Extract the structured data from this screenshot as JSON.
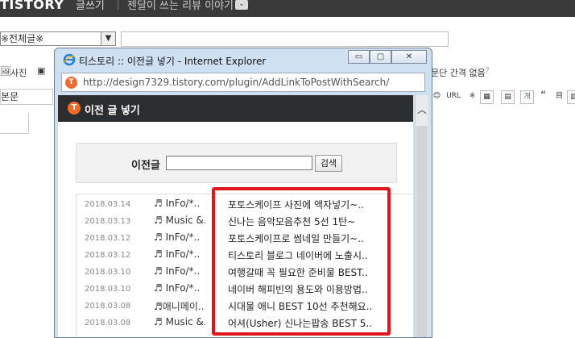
{
  "app": {
    "logo": "TISTORY",
    "page_name": "글쓰기",
    "blog_name": "젠달이 쓰는 리뷰 이야기",
    "blog_dropdown": "⌄"
  },
  "editor": {
    "category_value": "※전체글※",
    "toolbar1": {
      "photo_label": "사진",
      "paragraph_spacing_label": "문단 간격 없음"
    },
    "format_value": "본문",
    "toolbar2_buttons": [
      "😊",
      "URL",
      "※",
      "▦",
      "▤",
      "개",
      "“",
      "目",
      "▥"
    ]
  },
  "popup": {
    "window_title": "티스토리 :: 이전글 넣기 - Internet Explorer",
    "url": "http://design7329.tistory.com/plugin/AddLinkToPostWithSearch/",
    "header_title": "이전 글 넣기",
    "search_label": "이전글",
    "search_button": "검색",
    "posts": [
      {
        "date": "2018.03.14",
        "category": "♬ InFo/*..",
        "title": "포토스케이프 사진에 액자넣기~.."
      },
      {
        "date": "2018.03.13",
        "category": "♬ Music &..",
        "title": "신나는 음악모음추천 5선 1탄~"
      },
      {
        "date": "2018.03.12",
        "category": "♬ InFo/*..",
        "title": "포토스케이프로 썸네일 만들기~.."
      },
      {
        "date": "2018.03.12",
        "category": "♬ InFo/*..",
        "title": "티스토리 블로그 네이버에 노출시.."
      },
      {
        "date": "2018.03.10",
        "category": "♬ InFo/*..",
        "title": "여행갈때 꼭 필요한 준비물 BEST.."
      },
      {
        "date": "2018.03.10",
        "category": "♬ InFo/*..",
        "title": "네이버 해피빈의 용도와 이용방법.."
      },
      {
        "date": "2018.03.08",
        "category": "♬애니메이..",
        "title": "시대물 애니 BEST 10선 추천해요.."
      },
      {
        "date": "2018.03.08",
        "category": "♬ Music &..",
        "title": "어셔(Usher) 신나는팝송 BEST 5.."
      }
    ]
  },
  "colors": {
    "highlight": "#e0161c",
    "tistory_orange": "#f26b2b",
    "topbar": "#3a3a3a"
  }
}
